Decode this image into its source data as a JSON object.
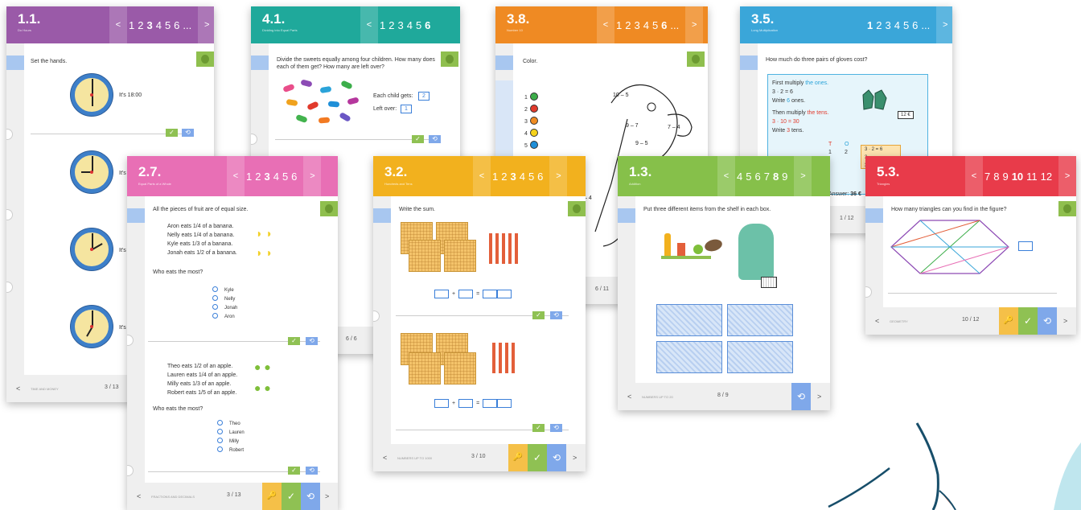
{
  "c11": {
    "num": "1.1.",
    "sub": "Do Hours",
    "nav": [
      "1",
      "2",
      "3",
      "4",
      "5",
      "6",
      "..."
    ],
    "sel": "3",
    "q": "Set the hands.",
    "a1": "It's 18:00",
    "a2": "It's",
    "a3": "It's",
    "a4": "It's",
    "sec": "TIME AND MONEY",
    "page": "3 / 13"
  },
  "c41": {
    "num": "4.1.",
    "sub": "Dividing into Equal Parts",
    "nav": [
      "1",
      "2",
      "3",
      "4",
      "5",
      "6"
    ],
    "sel": "6",
    "q": "Divide the sweets equally among four children. How many does each of them get? How many are left over?",
    "each": "Each child gets:",
    "left": "Left over:",
    "ev": "2",
    "lv": "1",
    "page": "6 / 6"
  },
  "c38": {
    "num": "3.8.",
    "sub": "Number 10",
    "nav": [
      "1",
      "2",
      "3",
      "4",
      "5",
      "6",
      "..."
    ],
    "sel": "6",
    "q": "Color.",
    "nums": [
      "1",
      "2",
      "3",
      "4",
      "5"
    ],
    "colors": [
      "#3cae4a",
      "#e13a2c",
      "#ef8c22",
      "#f5d21a",
      "#1f8fd8"
    ],
    "page": "6 / 11",
    "parrot": [
      "10 – 5",
      "9 – 7",
      "7 – 4",
      "9 – 5",
      "– 4"
    ]
  },
  "c35": {
    "num": "3.5.",
    "sub": "Long Multiplication",
    "nav": [
      "1",
      "2",
      "3",
      "4",
      "5",
      "6",
      "..."
    ],
    "sel": "1",
    "q": "How much do three pairs of gloves cost?",
    "l1a": "First multiply ",
    "l1b": "the ones.",
    "l2": "3 · 2 = 6",
    "l3a": "Write ",
    "l3b": "6",
    "l3c": " ones.",
    "l4a": "Then multiply ",
    "l4b": "the tens.",
    "l5": "3 · 10 = 30",
    "l6a": "Write ",
    "l6b": "3",
    "l6c": " tens.",
    "price": "12 €",
    "t": "T",
    "o": "O",
    "r1": "1",
    "r2": "2",
    "m1": "3 · 2 = 6",
    "m2": "3",
    "m3": "3",
    "ans": "Answer: ",
    "ansv": "36 €",
    "page": "1 / 12"
  },
  "c27": {
    "num": "2.7.",
    "sub": "Equal Parts of a Whole",
    "nav": [
      "1",
      "2",
      "3",
      "4",
      "5",
      "6"
    ],
    "sel": "3",
    "q": "All the pieces of fruit are of equal size.",
    "b1": "Aron eats 1/4 of a banana.",
    "b2": "Nelly eats 1/4 of a banana.",
    "b3": "Kyle eats 1/3 of a banana.",
    "b4": "Jonah eats 1/2 of a banana.",
    "w1": "Who eats the most?",
    "o1": [
      "Kyle",
      "Nelly",
      "Jonah",
      "Aron"
    ],
    "p1": "Theo eats 1/2 of an apple.",
    "p2": "Lauren eats 1/4 of an apple.",
    "p3": "Milly eats 1/3 of an apple.",
    "p4": "Robert eats 1/5 of an apple.",
    "w2": "Who eats the most?",
    "o2": [
      "Theo",
      "Lauren",
      "Milly",
      "Robert"
    ],
    "sec": "FRACTIONS AND DECIMALS",
    "page": "3 / 13"
  },
  "c32": {
    "num": "3.2.",
    "sub": "Hundreds and Tens",
    "nav": [
      "1",
      "2",
      "3",
      "4",
      "5",
      "6"
    ],
    "sel": "3",
    "q": "Write the sum.",
    "plus": "+",
    "eq": "=",
    "sec": "NUMBERS UP TO 1000",
    "page": "3 / 10"
  },
  "c13": {
    "num": "1.3.",
    "sub": "Addition",
    "nav": [
      "4",
      "5",
      "6",
      "7",
      "8",
      "9"
    ],
    "sel": "8",
    "q": "Put three different items from the shelf in each box.",
    "sec": "NUMBERS UP TO 20",
    "page": "8 / 9"
  },
  "c53": {
    "num": "5.3.",
    "sub": "Triangles",
    "nav": [
      "7",
      "8",
      "9",
      "10",
      "11",
      "12"
    ],
    "sel": "10",
    "q": "How many triangles can you find in the figure?",
    "sec": "GEOMETRY",
    "page": "10 / 12"
  },
  "icons": {
    "prev": "<",
    "next": ">",
    "check": "✓",
    "reset": "⟲",
    "key": "🔑"
  }
}
